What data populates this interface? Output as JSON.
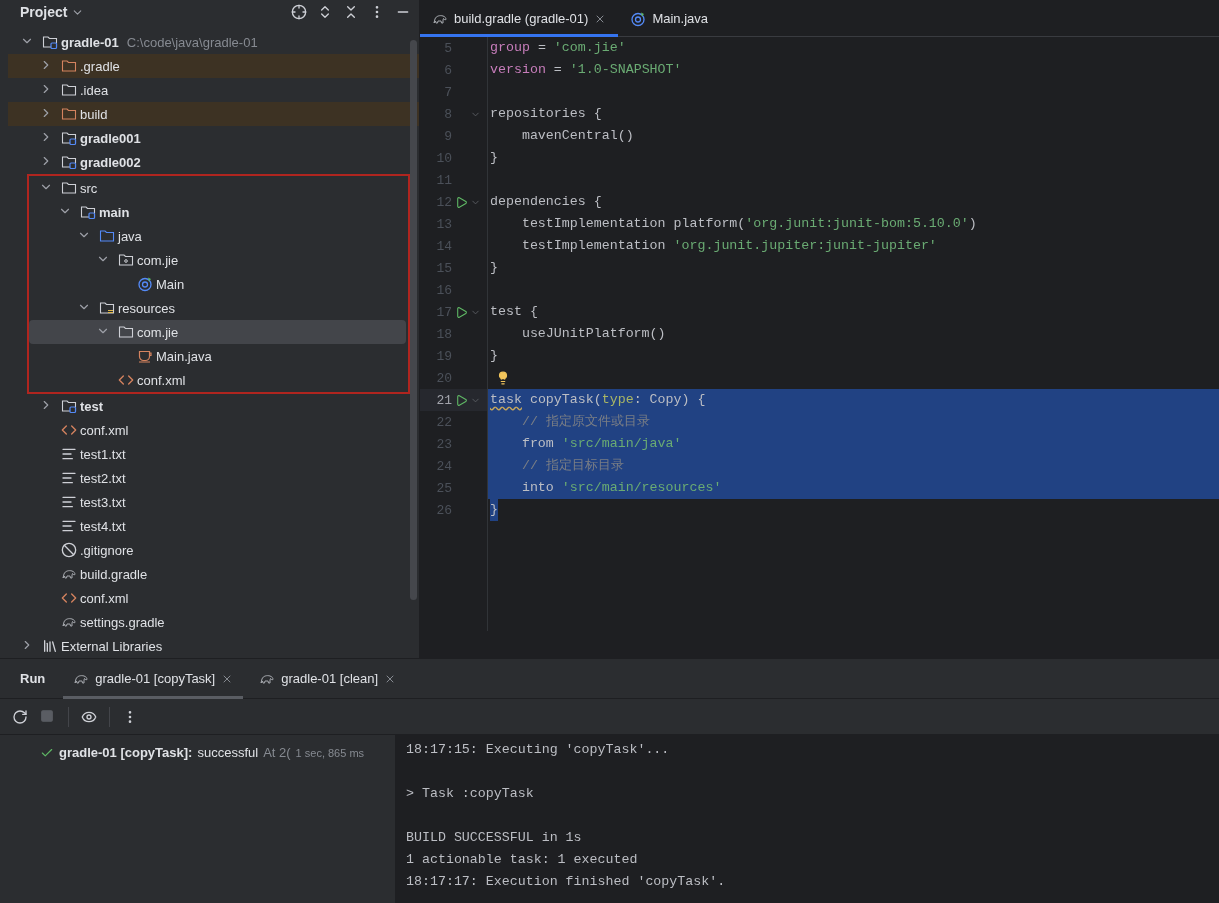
{
  "project": {
    "title": "Project",
    "tree": [
      {
        "name": "gradle-01",
        "path": "C:\\code\\java\\gradle-01",
        "kind": "module",
        "expanded": true,
        "selected": false,
        "framed": false,
        "children": [
          {
            "name": ".gradle",
            "kind": "excluded-folder",
            "expanded": false,
            "selected": false,
            "framed": false
          },
          {
            "name": ".idea",
            "kind": "folder",
            "expanded": false,
            "selected": false,
            "framed": false
          },
          {
            "name": "build",
            "kind": "excluded-folder",
            "expanded": false,
            "selected": false,
            "framed": false
          },
          {
            "name": "gradle001",
            "kind": "module",
            "expanded": false,
            "selected": false,
            "framed": false
          },
          {
            "name": "gradle002",
            "kind": "module",
            "expanded": false,
            "selected": false,
            "framed": false
          },
          {
            "name": "src",
            "kind": "folder",
            "expanded": true,
            "selected": false,
            "framed": true,
            "children": [
              {
                "name": "main",
                "kind": "module",
                "expanded": true,
                "selected": false,
                "framed": false,
                "children": [
                  {
                    "name": "java",
                    "kind": "source-folder",
                    "expanded": true,
                    "selected": false,
                    "framed": false,
                    "children": [
                      {
                        "name": "com.jie",
                        "kind": "package",
                        "expanded": true,
                        "selected": false,
                        "framed": false,
                        "children": [
                          {
                            "name": "Main",
                            "kind": "class",
                            "selected": false,
                            "framed": false
                          }
                        ]
                      }
                    ]
                  },
                  {
                    "name": "resources",
                    "kind": "resources",
                    "expanded": true,
                    "selected": false,
                    "framed": false,
                    "children": [
                      {
                        "name": "com.jie",
                        "kind": "folder",
                        "expanded": true,
                        "selected": true,
                        "framed": false,
                        "children": [
                          {
                            "name": "Main.java",
                            "kind": "java-file",
                            "selected": false,
                            "framed": false
                          }
                        ]
                      },
                      {
                        "name": "conf.xml",
                        "kind": "xml",
                        "selected": false,
                        "framed": false
                      }
                    ]
                  }
                ]
              }
            ]
          },
          {
            "name": "test",
            "kind": "module",
            "expanded": false,
            "selected": false,
            "framed": false
          },
          {
            "name": "conf.xml",
            "kind": "xml",
            "selected": false,
            "framed": false
          },
          {
            "name": "test1.txt",
            "kind": "text",
            "selected": false,
            "framed": false
          },
          {
            "name": "test2.txt",
            "kind": "text",
            "selected": false,
            "framed": false
          },
          {
            "name": "test3.txt",
            "kind": "text",
            "selected": false,
            "framed": false
          },
          {
            "name": "test4.txt",
            "kind": "text",
            "selected": false,
            "framed": false
          },
          {
            "name": ".gitignore",
            "kind": "gitignore",
            "selected": false,
            "framed": false
          },
          {
            "name": "build.gradle",
            "kind": "gradle",
            "selected": false,
            "framed": false
          },
          {
            "name": "conf.xml",
            "kind": "xml",
            "selected": false,
            "framed": false
          },
          {
            "name": "settings.gradle",
            "kind": "gradle",
            "selected": false,
            "framed": false
          }
        ]
      },
      {
        "name": "External Libraries",
        "kind": "library",
        "expanded": false,
        "selected": false,
        "framed": false
      }
    ]
  },
  "editor": {
    "tabs": [
      {
        "label": "build.gradle (gradle-01)",
        "kind": "gradle",
        "selected": true,
        "closable": true
      },
      {
        "label": "Main.java",
        "kind": "class",
        "selected": false,
        "closable": false
      }
    ],
    "lines": [
      {
        "number": "5",
        "run": false,
        "fold": false,
        "bulb": false,
        "selected": false,
        "indented": false,
        "tokens": [
          {
            "kind": "keyword",
            "text": "group"
          },
          {
            "kind": "plain",
            "text": " = "
          },
          {
            "kind": "string",
            "text": "'com.jie'"
          }
        ]
      },
      {
        "number": "6",
        "run": false,
        "fold": false,
        "bulb": false,
        "selected": false,
        "indented": false,
        "tokens": [
          {
            "kind": "keyword",
            "text": "version"
          },
          {
            "kind": "plain",
            "text": " = "
          },
          {
            "kind": "string",
            "text": "'1.0-SNAPSHOT'"
          }
        ]
      },
      {
        "number": "7",
        "run": false,
        "fold": false,
        "bulb": false,
        "selected": false
      },
      {
        "number": "8",
        "run": false,
        "fold": true,
        "bulb": false,
        "selected": false,
        "indented": false,
        "tokens": [
          {
            "kind": "plain",
            "text": "repositories {"
          }
        ]
      },
      {
        "number": "9",
        "run": false,
        "fold": false,
        "bulb": false,
        "selected": false,
        "indented": true,
        "tokens": [
          {
            "kind": "plain",
            "text": "mavenCentral()"
          }
        ]
      },
      {
        "number": "10",
        "run": false,
        "fold": false,
        "bulb": false,
        "selected": false,
        "indented": false,
        "tokens": [
          {
            "kind": "plain",
            "text": "}"
          }
        ]
      },
      {
        "number": "11",
        "run": false,
        "fold": false,
        "bulb": false,
        "selected": false
      },
      {
        "number": "12",
        "run": true,
        "fold": true,
        "bulb": false,
        "selected": false,
        "indented": false,
        "tokens": [
          {
            "kind": "plain",
            "text": "dependencies {"
          }
        ]
      },
      {
        "number": "13",
        "run": false,
        "fold": false,
        "bulb": false,
        "selected": false,
        "indented": true,
        "tokens": [
          {
            "kind": "plain",
            "text": "testImplementation platform("
          },
          {
            "kind": "string",
            "text": "'org.junit:junit-bom:5.10.0'"
          },
          {
            "kind": "plain",
            "text": ")"
          }
        ]
      },
      {
        "number": "14",
        "run": false,
        "fold": false,
        "bulb": false,
        "selected": false,
        "indented": true,
        "tokens": [
          {
            "kind": "plain",
            "text": "testImplementation "
          },
          {
            "kind": "string",
            "text": "'org.junit.jupiter:junit-jupiter'"
          }
        ]
      },
      {
        "number": "15",
        "run": false,
        "fold": false,
        "bulb": false,
        "selected": false,
        "indented": false,
        "tokens": [
          {
            "kind": "plain",
            "text": "}"
          }
        ]
      },
      {
        "number": "16",
        "run": false,
        "fold": false,
        "bulb": false,
        "selected": false
      },
      {
        "number": "17",
        "run": true,
        "fold": true,
        "bulb": false,
        "selected": false,
        "indented": false,
        "tokens": [
          {
            "kind": "plain",
            "text": "test {"
          }
        ]
      },
      {
        "number": "18",
        "run": false,
        "fold": false,
        "bulb": false,
        "selected": false,
        "indented": true,
        "tokens": [
          {
            "kind": "plain",
            "text": "useJUnitPlatform()"
          }
        ]
      },
      {
        "number": "19",
        "run": false,
        "fold": false,
        "bulb": false,
        "selected": false,
        "indented": false,
        "tokens": [
          {
            "kind": "plain",
            "text": "}"
          }
        ]
      },
      {
        "number": "20",
        "run": false,
        "fold": false,
        "bulb": true,
        "selected": false
      },
      {
        "number": "21",
        "run": true,
        "fold": true,
        "bulb": false,
        "selected": true,
        "indented": false,
        "tokens": [
          {
            "kind": "warning",
            "text": "task"
          },
          {
            "kind": "plain",
            "text": " copyTask("
          },
          {
            "kind": "param",
            "text": "type"
          },
          {
            "kind": "plain",
            "text": ": Copy) {"
          }
        ]
      },
      {
        "number": "22",
        "run": false,
        "fold": false,
        "bulb": false,
        "selected": true,
        "indented": true,
        "tokens": [
          {
            "kind": "comment",
            "text": "// 指定原文件或目录"
          }
        ]
      },
      {
        "number": "23",
        "run": false,
        "fold": false,
        "bulb": false,
        "selected": true,
        "indented": true,
        "tokens": [
          {
            "kind": "plain",
            "text": "from "
          },
          {
            "kind": "string",
            "text": "'src/main/java'"
          }
        ]
      },
      {
        "number": "24",
        "run": false,
        "fold": false,
        "bulb": false,
        "selected": true,
        "indented": true,
        "tokens": [
          {
            "kind": "comment",
            "text": "// 指定目标目录"
          }
        ]
      },
      {
        "number": "25",
        "run": false,
        "fold": false,
        "bulb": false,
        "selected": true,
        "indented": true,
        "tokens": [
          {
            "kind": "plain",
            "text": "into "
          },
          {
            "kind": "string",
            "text": "'src/main/resources'"
          }
        ]
      },
      {
        "number": "26",
        "run": false,
        "fold": false,
        "bulb": false,
        "selected": true,
        "indented": false,
        "tokens": [
          {
            "kind": "plain",
            "text": "}"
          }
        ]
      }
    ]
  },
  "run": {
    "title": "Run",
    "tabs": [
      {
        "label": "gradle-01 [copyTask]",
        "selected": true
      },
      {
        "label": "gradle-01 [clean]",
        "selected": false
      }
    ],
    "result": {
      "succeeded": true,
      "task": "gradle-01 [copyTask]:",
      "outcome": "successful",
      "time": "At 2(",
      "duration": "1 sec, 865 ms"
    },
    "console": [
      [
        "18:17:15: Executing 'copyTask'..."
      ],
      [
        "> Task :copyTask"
      ],
      [
        "BUILD SUCCESSFUL in 1s",
        "1 actionable task: 1 executed",
        "18:17:17: Execution finished 'copyTask'."
      ]
    ]
  }
}
